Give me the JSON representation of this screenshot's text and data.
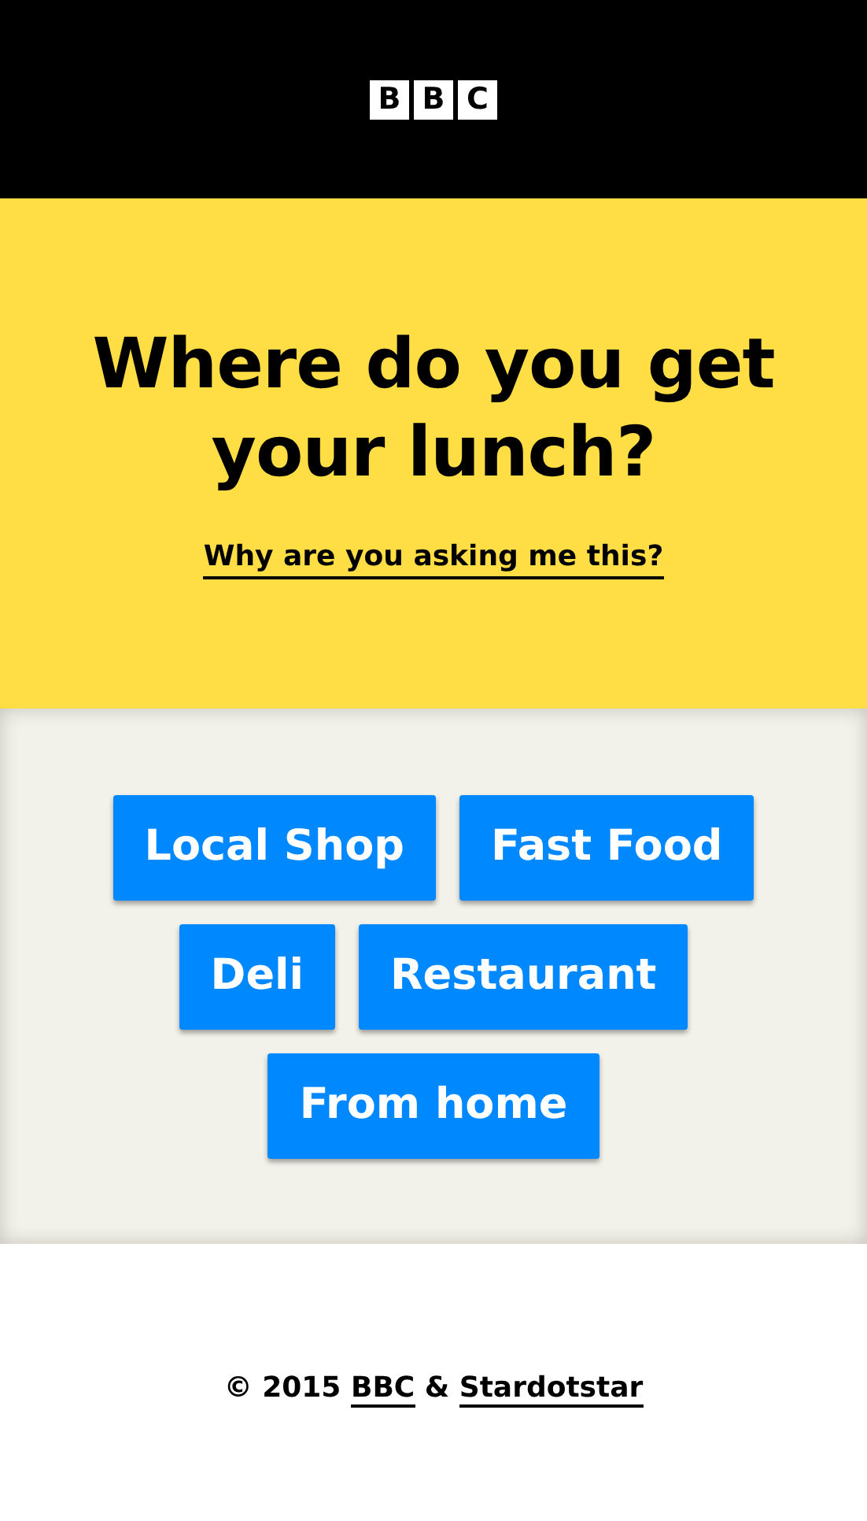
{
  "logo": {
    "letters": [
      "B",
      "B",
      "C"
    ]
  },
  "question": {
    "title": "Where do you get your lunch?",
    "link": "Why are you asking me this?"
  },
  "answers": [
    {
      "label": "Local Shop"
    },
    {
      "label": "Fast Food"
    },
    {
      "label": "Deli"
    },
    {
      "label": "Restaurant"
    },
    {
      "label": "From home"
    }
  ],
  "footer": {
    "prefix": "© 2015",
    "links": [
      "BBC",
      "Stardotstar"
    ],
    "separator": "&"
  }
}
